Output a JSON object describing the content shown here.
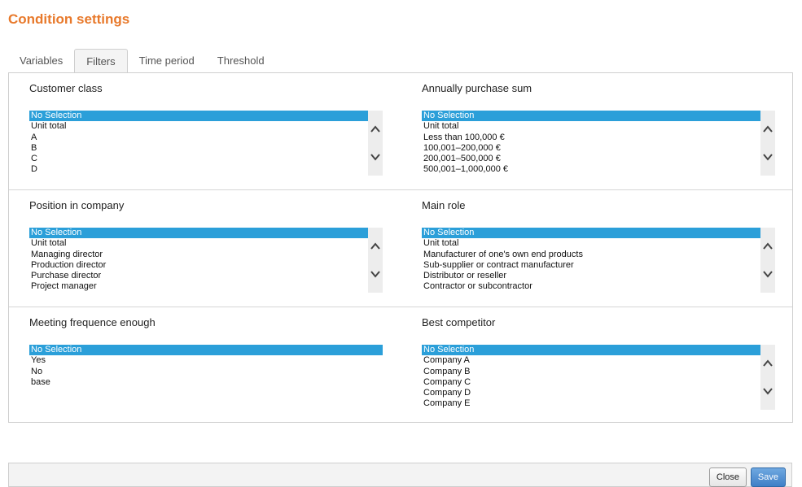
{
  "page": {
    "title": "Condition settings"
  },
  "tabs": [
    {
      "label": "Variables",
      "active": false
    },
    {
      "label": "Filters",
      "active": true
    },
    {
      "label": "Time period",
      "active": false
    },
    {
      "label": "Threshold",
      "active": false
    }
  ],
  "filters": {
    "customer_class": {
      "label": "Customer class",
      "options": [
        "No Selection",
        "Unit total",
        "A",
        "B",
        "C",
        "D"
      ],
      "selected": "No Selection"
    },
    "annual_purchase_sum": {
      "label": "Annually purchase sum",
      "options": [
        "No Selection",
        "Unit total",
        "Less than 100,000 €",
        "100,001–200,000 €",
        "200,001–500,000 €",
        "500,001–1,000,000 €"
      ],
      "selected": "No Selection"
    },
    "position_in_company": {
      "label": "Position in company",
      "options": [
        "No Selection",
        "Unit total",
        "Managing director",
        "Production director",
        "Purchase director",
        "Project manager"
      ],
      "selected": "No Selection"
    },
    "main_role": {
      "label": "Main role",
      "options": [
        "No Selection",
        "Unit total",
        "Manufacturer of one's own end products",
        "Sub-supplier or contract manufacturer",
        "Distributor or reseller",
        "Contractor or subcontractor"
      ],
      "selected": "No Selection"
    },
    "meeting_frequence": {
      "label": "Meeting frequence enough",
      "options": [
        "No Selection",
        "Yes",
        "No",
        "base"
      ],
      "selected": "No Selection"
    },
    "best_competitor": {
      "label": "Best competitor",
      "options": [
        "No Selection",
        "Company A",
        "Company B",
        "Company C",
        "Company D",
        "Company E"
      ],
      "selected": "No Selection"
    }
  },
  "footer": {
    "close_label": "Close",
    "save_label": "Save"
  },
  "colors": {
    "title": "#e8792b",
    "selection": "#2b9fd9",
    "save_button": "#3f7fc7"
  },
  "icons": {
    "scroll_up": "chevron-up-icon",
    "scroll_down": "chevron-down-icon"
  }
}
